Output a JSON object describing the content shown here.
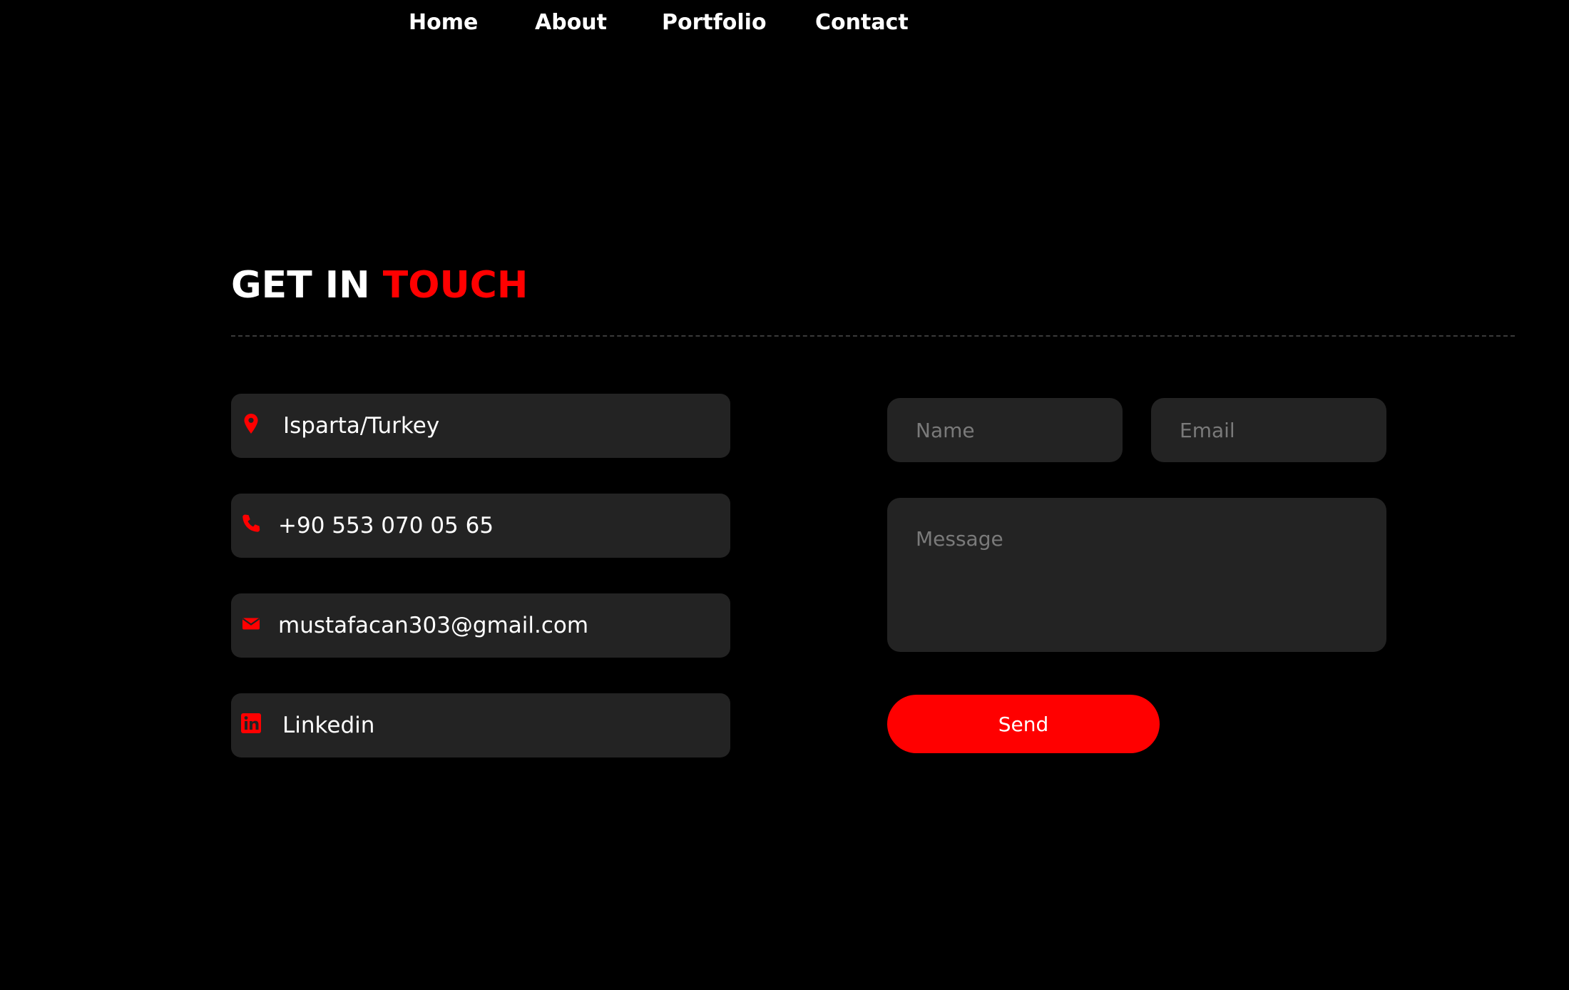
{
  "nav": {
    "items": [
      {
        "label": "Home"
      },
      {
        "label": "About"
      },
      {
        "label": "Portfolio"
      },
      {
        "label": "Contact"
      }
    ]
  },
  "contact": {
    "heading_white": "GET IN",
    "heading_red": "TOUCH",
    "info": [
      {
        "icon": "map-pin-icon",
        "text": "Isparta/Turkey"
      },
      {
        "icon": "phone-icon",
        "text": "+90 553 070 05 65"
      },
      {
        "icon": "envelope-icon",
        "text": "mustafacan303@gmail.com"
      },
      {
        "icon": "linkedin-icon",
        "text": "Linkedin"
      }
    ],
    "form": {
      "name_placeholder": "Name",
      "email_placeholder": "Email",
      "message_placeholder": "Message",
      "send_label": "Send"
    }
  },
  "colors": {
    "background": "#000000",
    "accent": "#ff0000",
    "card": "#232323",
    "text": "#ffffff",
    "placeholder": "#7a7a7a"
  }
}
